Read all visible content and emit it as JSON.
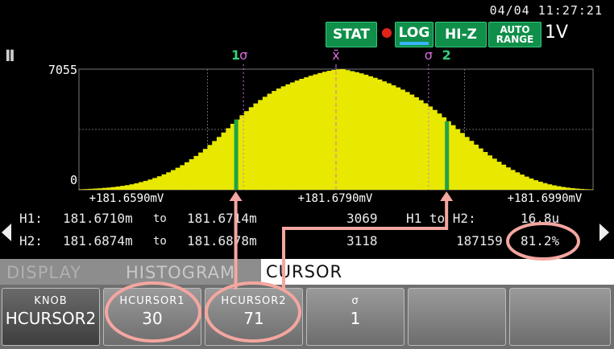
{
  "header": {
    "datetime": "04/04  11:27:21",
    "badges": {
      "stat": "STAT",
      "log": "LOG",
      "hiz": "HI-Z",
      "auto_1": "AUTO",
      "auto_2": "RANGE"
    },
    "range": "1V",
    "icons": {
      "pause": "pause-icon",
      "record": "record-dot-icon"
    }
  },
  "chart_data": {
    "type": "bar",
    "y_max_label": "7055",
    "y_min_label": "0",
    "x_tick_labels": [
      "+181.6590mV",
      "+181.6790mV",
      "+181.6990mV"
    ],
    "xlim": [
      181.659,
      181.699
    ],
    "ylim": [
      0,
      7055
    ],
    "grid": true,
    "bar_color": "#e8e800",
    "cursor_color": "#1fa34a",
    "cursor_labels": [
      "1",
      "2"
    ],
    "cursor_positions_mV": [
      181.6712,
      181.6876
    ],
    "sigma_labels": [
      "σ",
      "σ"
    ],
    "sigma_positions_mV": [
      181.6718,
      181.6862
    ],
    "mean_label": "x̄",
    "mean_position_mV": 181.679,
    "values": [
      30,
      40,
      55,
      70,
      85,
      110,
      130,
      160,
      190,
      230,
      270,
      320,
      380,
      450,
      520,
      600,
      690,
      790,
      900,
      1020,
      1150,
      1290,
      1440,
      1610,
      1790,
      1980,
      2180,
      2390,
      2620,
      2850,
      3090,
      3350,
      3600,
      3860,
      4110,
      4360,
      4600,
      4830,
      5050,
      5250,
      5440,
      5620,
      5780,
      5920,
      6050,
      6170,
      6280,
      6390,
      6490,
      6580,
      6670,
      6750,
      6830,
      6900,
      6960,
      7010,
      7040,
      7055,
      7000,
      6940,
      6880,
      6810,
      6730,
      6640,
      6550,
      6450,
      6340,
      6230,
      6110,
      5990,
      5860,
      5720,
      5570,
      5410,
      5240,
      5060,
      4870,
      4670,
      4460,
      4240,
      4010,
      3780,
      3550,
      3320,
      3090,
      2860,
      2640,
      2420,
      2210,
      2010,
      1820,
      1640,
      1470,
      1310,
      1160,
      1020,
      890,
      770,
      660,
      560,
      470,
      390,
      320,
      260,
      210,
      165,
      125,
      95,
      70,
      50,
      35,
      25
    ]
  },
  "stats": {
    "h1_label": "H1:",
    "h1_from": "181.6710m",
    "h1_to_word": "to",
    "h1_to": "181.6714m",
    "h1_count": "3069",
    "diff_label": "H1 to H2:",
    "diff_value": "16.8u",
    "h2_label": "H2:",
    "h2_from": "181.6874m",
    "h2_to_word": "to",
    "h2_to": "181.6878m",
    "h2_count": "3118",
    "total": "187159",
    "percent": "81.2%"
  },
  "tabs": [
    "DISPLAY",
    "HISTOGRAM",
    "CURSOR"
  ],
  "softkeys": [
    {
      "label": "KNOB",
      "value": "HCURSOR2"
    },
    {
      "label": "HCURSOR1",
      "value": "30"
    },
    {
      "label": "HCURSOR2",
      "value": "71"
    },
    {
      "label": "σ",
      "value": "1"
    },
    {
      "label": "",
      "value": ""
    },
    {
      "label": "",
      "value": ""
    }
  ],
  "annotation_color": "#f4a6a0"
}
